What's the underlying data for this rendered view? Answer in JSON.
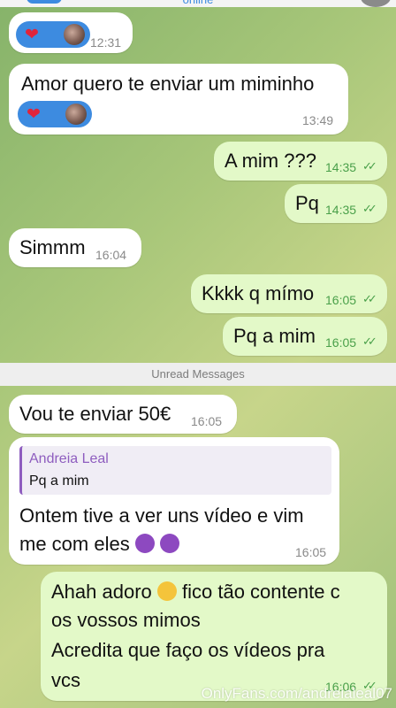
{
  "header": {
    "status": "online"
  },
  "messages": [
    {
      "dir": "in",
      "time": "12:31",
      "reaction": "heart-with-avatar"
    },
    {
      "dir": "in",
      "text": "Amor quero te enviar um miminho",
      "time": "13:49",
      "reaction": "heart-with-avatar"
    },
    {
      "dir": "out",
      "text": "A mim ???",
      "time": "14:35",
      "read": true
    },
    {
      "dir": "out",
      "text": "Pq",
      "time": "14:35",
      "read": true
    },
    {
      "dir": "in",
      "text": "Simmm",
      "time": "16:04"
    },
    {
      "dir": "out",
      "text": "Kkkk q mímo",
      "time": "16:05",
      "read": true
    },
    {
      "dir": "out",
      "text": "Pq a mim",
      "time": "16:05",
      "read": true
    },
    {
      "dir": "in",
      "text": "Vou te enviar 50€",
      "time": "16:05"
    },
    {
      "dir": "in",
      "reply_to": {
        "name": "Andreia Leal",
        "text": "Pq a mim"
      },
      "lines": [
        "Ontem tive a ver uns vídeo e vim",
        "me com eles"
      ],
      "emojis": [
        "smiling-devil-emoji",
        "smiling-devil-emoji"
      ],
      "time": "16:05"
    },
    {
      "dir": "out",
      "lines": [
        "Ahah adoro",
        "fico tão contente c",
        "os vossos mimos",
        "Acredita que faço os vídeos pra",
        "vcs"
      ],
      "emoji": "heart-eyes-cat-emoji",
      "time": "16:06",
      "read": true
    }
  ],
  "divider": {
    "label": "Unread Messages"
  },
  "watermark": "OnlyFans.com/andreialeal07",
  "colors": {
    "accent": "#3d8be0",
    "outgoing_bubble": "#e3f9c8",
    "incoming_bubble": "#ffffff",
    "read_check": "#4aa04a",
    "reply_name": "#8e5dbf",
    "reaction_heart": "#e0243a"
  }
}
